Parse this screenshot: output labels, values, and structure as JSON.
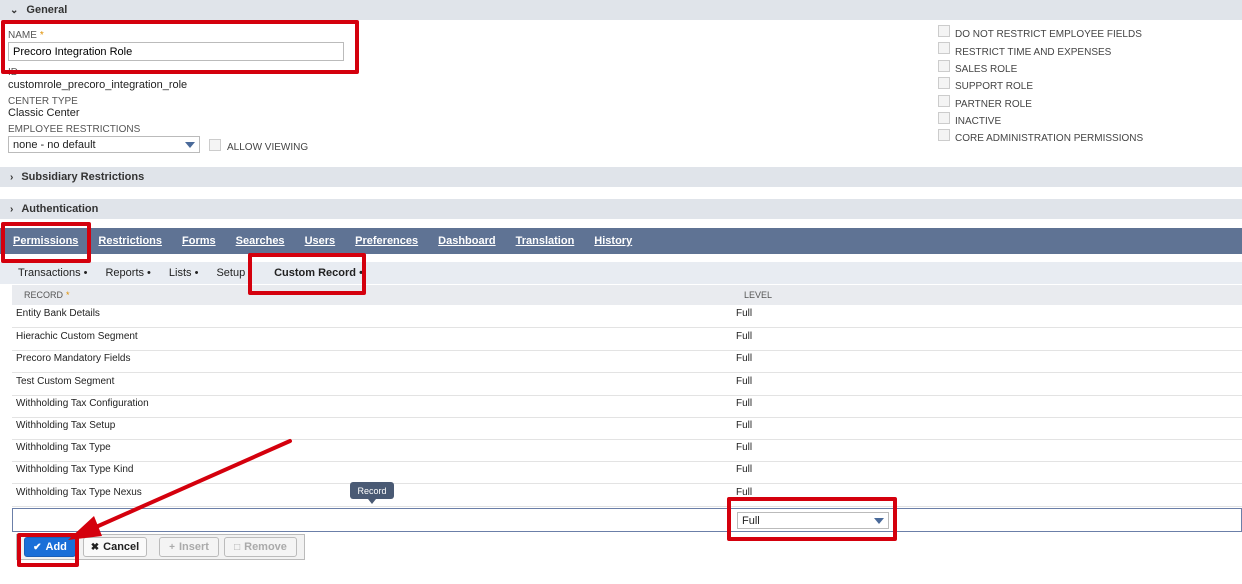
{
  "sections": {
    "general": "General",
    "subsidiary": "Subsidiary Restrictions",
    "authentication": "Authentication"
  },
  "form": {
    "name_label": "NAME",
    "name_required": "*",
    "name_value": "Precoro Integration Role",
    "id_label": "ID",
    "id_value": "customrole_precoro_integration_role",
    "center_type_label": "CENTER TYPE",
    "center_type_value": "Classic Center",
    "employee_restrictions_label": "EMPLOYEE RESTRICTIONS",
    "employee_restrictions_value": "none - no default",
    "allow_viewing_label": "ALLOW VIEWING"
  },
  "checkboxes": [
    "DO NOT RESTRICT EMPLOYEE FIELDS",
    "RESTRICT TIME AND EXPENSES",
    "SALES ROLE",
    "SUPPORT ROLE",
    "PARTNER ROLE",
    "INACTIVE",
    "CORE ADMINISTRATION PERMISSIONS"
  ],
  "tabs": [
    "Permissions",
    "Restrictions",
    "Forms",
    "Searches",
    "Users",
    "Preferences",
    "Dashboard",
    "Translation",
    "History"
  ],
  "subtabs": [
    "Transactions •",
    "Reports •",
    "Lists •",
    "Setup •",
    "Custom Record •"
  ],
  "grid": {
    "col_record": "RECORD",
    "col_required": "*",
    "col_level": "LEVEL",
    "rows": [
      {
        "record": "Entity Bank Details",
        "level": "Full"
      },
      {
        "record": "Hierachic Custom Segment",
        "level": "Full"
      },
      {
        "record": "Precoro Mandatory Fields",
        "level": "Full"
      },
      {
        "record": "Test Custom Segment",
        "level": "Full"
      },
      {
        "record": "Withholding Tax Configuration",
        "level": "Full"
      },
      {
        "record": "Withholding Tax Setup",
        "level": "Full"
      },
      {
        "record": "Withholding Tax Type",
        "level": "Full"
      },
      {
        "record": "Withholding Tax Type Kind",
        "level": "Full"
      },
      {
        "record": "Withholding Tax Type Nexus",
        "level": "Full"
      }
    ],
    "edit_level_value": "Full",
    "tooltip": "Record"
  },
  "buttons": {
    "add": "Add",
    "cancel": "Cancel",
    "insert": "Insert",
    "remove": "Remove"
  },
  "colors": {
    "tabbar": "#5f7394",
    "highlight": "#d4000d",
    "primary": "#1a6fd8"
  }
}
